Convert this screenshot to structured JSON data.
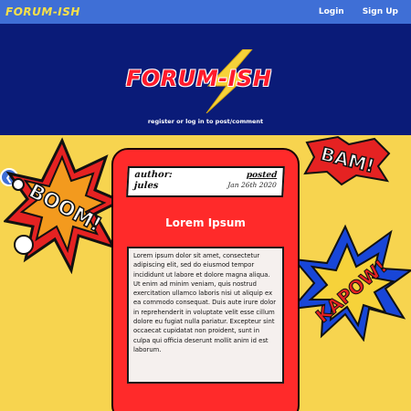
{
  "nav": {
    "brand": "FORUM-ISH",
    "login": "Login",
    "signup": "Sign Up"
  },
  "hero": {
    "logo_text": "FORUM-ISH",
    "tagline": "register or log in to post/comment"
  },
  "decorations": {
    "left": "BOOM!",
    "top_right": "BAM!",
    "right": "KAPOW!"
  },
  "post": {
    "author_label": "author:",
    "author_name": "jules",
    "posted_label": "posted",
    "date": "Jan 26th 2020",
    "title": "Lorem Ipsum",
    "body": "Lorem ipsum dolor sit amet, consectetur adipiscing elit, sed do eiusmod tempor incididunt ut labore et dolore magna aliqua. Ut enim ad minim veniam, quis nostrud exercitation ullamco laboris nisi ut aliquip ex ea commodo consequat. Duis aute irure dolor in reprehenderit in voluptate velit esse cillum dolore eu fugiat nulla pariatur. Excepteur sint occaecat cupidatat non proident, sunt in culpa qui officia deserunt mollit anim id est laborum."
  },
  "colors": {
    "nav_bg": "#3f6fd6",
    "hero_bg": "#0a1b78",
    "page_bg": "#f7d44f",
    "card_bg": "#ff2a2a",
    "bolt": "#f6d23a"
  }
}
